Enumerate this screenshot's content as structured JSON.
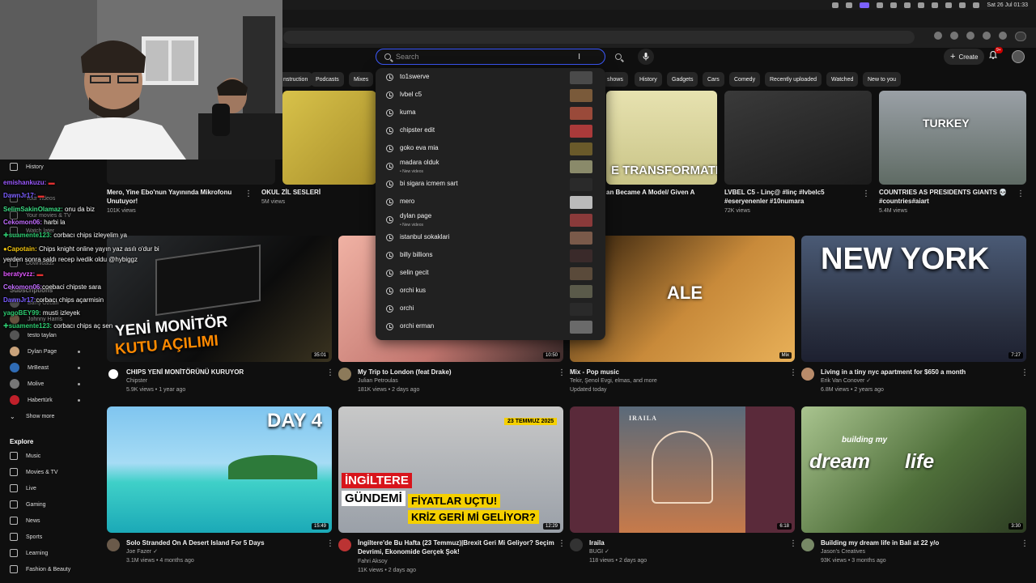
{
  "menubar": {
    "datetime": "Sat 26 Jul  01:33"
  },
  "search": {
    "placeholder": "Search"
  },
  "header": {
    "create_label": "Create",
    "notifications_badge": "9+"
  },
  "chips": [
    "nstruction",
    "Podcasts",
    "Mixes",
    "shows",
    "History",
    "Gadgets",
    "Cars",
    "Comedy",
    "Recently uploaded",
    "Watched",
    "New to you"
  ],
  "sidebar": {
    "you_items": [
      "History",
      "Your videos",
      "Your movies & TV",
      "Watch later",
      "Downloads"
    ],
    "subscriptions_heading": "Subscriptions",
    "subscriptions": [
      "Barış Özcan",
      "Johnny Harris",
      "testo taylan",
      "Dylan Page",
      "MrBeast",
      "Molive",
      "Habertürk"
    ],
    "show_more": "Show more",
    "explore_heading": "Explore",
    "explore": [
      "Music",
      "Movies & TV",
      "Live",
      "Gaming",
      "News",
      "Sports",
      "Learning",
      "Fashion & Beauty"
    ]
  },
  "chat": [
    {
      "user": "emishankuzu:",
      "msg": "",
      "color": "#9b59ff"
    },
    {
      "user": "DawnJr17:",
      "msg": "",
      "color": "#7a5cff"
    },
    {
      "user": "SelimSakinOlamaz:",
      "msg": "onu da biz",
      "color": "#3ddc84"
    },
    {
      "user": "Cekomon06:",
      "msg": "harbi la",
      "color": "#c26cff"
    },
    {
      "user": "suamente123:",
      "msg": "corbacı chips izleyelim ya",
      "color": "#2ecc71"
    },
    {
      "user": "Capotain:",
      "msg": "Chips knight online yayın yaz asılı o'dur bi",
      "color": "#f1c40f"
    },
    {
      "user": "",
      "msg": "yerden sonra saldı recep ivedik oldu @hybiggz",
      "color": "#ffffff"
    },
    {
      "user": "beratyvzz:",
      "msg": "",
      "color": "#e056fd"
    },
    {
      "user": "Cekomon06:",
      "msg": "coebaci chipste sara",
      "color": "#c26cff"
    },
    {
      "user": "DawnJr17:",
      "msg": "corbacı chips açarmisin",
      "color": "#7a5cff"
    },
    {
      "user": "yagoBEY99:",
      "msg": "musti izleyek",
      "color": "#2ecc71"
    },
    {
      "user": "suamente123:",
      "msg": "corbacı chips aç sen",
      "color": "#2ecc71"
    }
  ],
  "suggestions": [
    {
      "text": "to1swerve",
      "sub": ""
    },
    {
      "text": "lvbel c5",
      "sub": ""
    },
    {
      "text": "kuma",
      "sub": ""
    },
    {
      "text": "chipster edit",
      "sub": ""
    },
    {
      "text": "goko eva mia",
      "sub": ""
    },
    {
      "text": "madara olduk",
      "sub": "• New videos"
    },
    {
      "text": "bi sigara icmem sart",
      "sub": ""
    },
    {
      "text": "mero",
      "sub": ""
    },
    {
      "text": "dylan page",
      "sub": "• New videos"
    },
    {
      "text": "istanbul sokaklari",
      "sub": ""
    },
    {
      "text": "billy billions",
      "sub": ""
    },
    {
      "text": "selin gecit",
      "sub": ""
    },
    {
      "text": "orchi kus",
      "sub": ""
    },
    {
      "text": "orchi",
      "sub": ""
    },
    {
      "text": "orchi erman",
      "sub": ""
    }
  ],
  "row1": [
    {
      "title1": "Mero, Yine Ebo'nun Yayınında Mikrofonu",
      "title2": "Unutuyor!",
      "meta": "101K views"
    },
    {
      "title1": "OKUL ZİL SESLERİ",
      "title2": "",
      "meta": "5M views"
    },
    {
      "title1": "an Became A Model/ Given A",
      "title2": "",
      "meta": ""
    },
    {
      "title1": "LVBEL C5 - Linç@ #linç #lvbelc5",
      "title2": "#eseryenenler #10numara",
      "meta": "72K views"
    },
    {
      "title1": "COUNTRIES AS PRESIDENTS GIANTS 💀",
      "title2": "#countries#aiart",
      "meta": "5.4M views"
    }
  ],
  "row1_overlays": {
    "transform": "E TRANSFORMATIO",
    "turkey": "TURKEY"
  },
  "row2": [
    {
      "title": "CHIPS YENİ MONİTÖRÜNÜ KURUYOR",
      "channel": "Chipster",
      "meta": "5.9K views • 1 year ago",
      "duration": "35:01",
      "overlay1": "YENİ MONİTÖR",
      "overlay2": "KUTU AÇILIMI"
    },
    {
      "title": "My Trip to London (feat Drake)",
      "channel": "Julian Petroulas",
      "meta": "181K views • 2 days ago",
      "duration": "10:50"
    },
    {
      "title": "Mix - Pop music",
      "channel": "Tekir, Şenol Evgi, elmas, and more",
      "meta": "Updated today",
      "duration": "Mix",
      "overlay1": "ALE"
    },
    {
      "title": "Living in a tiny nyc apartment for $650 a month",
      "channel": "Erik Van Conover ✓",
      "meta": "6.8M views • 2 years ago",
      "duration": "7:27",
      "overlay1": "NEW YORK"
    }
  ],
  "row3": [
    {
      "title1": "Solo Stranded On A Desert Island For 5 Days",
      "title2": "",
      "channel": "Joe Fazer ✓",
      "meta": "3.1M views • 4 months ago",
      "duration": "15:49",
      "overlay1": "DAY 4"
    },
    {
      "title1": "İngiltere'de Bu Hafta (23 Temmuz)|Brexit Geri Mi Geliyor? Seçim",
      "title2": "Devrimi, Ekonomide Gerçek Şok!",
      "channel": "Fahri Aksoy",
      "meta": "11K views • 2 days ago",
      "duration": "12:29",
      "overlay1": "İNGİLTERE",
      "overlay2": "GÜNDEMİ",
      "overlay3": "FİYATLAR UÇTU!",
      "overlay4": "KRİZ GERİ Mİ GELİYOR?",
      "overlay5": "23 TEMMUZ 2025"
    },
    {
      "title1": "Iraila",
      "title2": "",
      "channel": "BUGI ✓",
      "meta": "118 views • 2 days ago",
      "duration": "6:18",
      "overlay1": "IRAILA"
    },
    {
      "title1": "Building my dream life in Bali at 22 y/o",
      "title2": "",
      "channel": "Jason's Creatives",
      "meta": "93K views • 3 months ago",
      "duration": "3:30",
      "overlay1": "building my",
      "overlay2": "dream",
      "overlay3": "life"
    }
  ]
}
